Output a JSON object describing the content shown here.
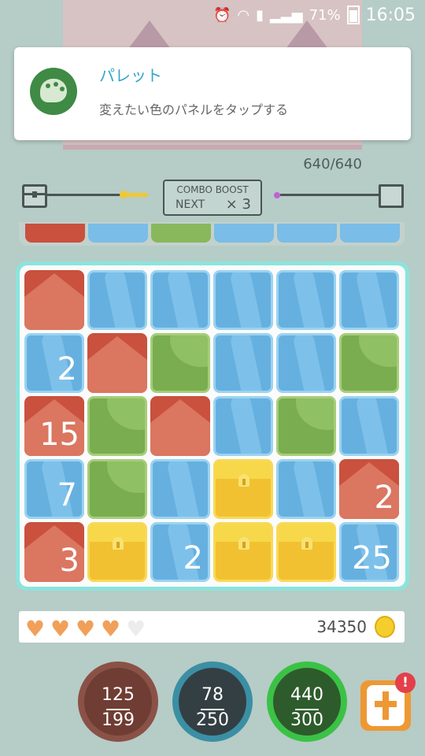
{
  "status": {
    "time": "16:05",
    "battery": "71%"
  },
  "notification": {
    "title": "パレット",
    "body": "変えたい色のパネルをタップする",
    "icon": "palette-icon"
  },
  "hp": "640/640",
  "combo": {
    "title": "COMBO BOOST",
    "next": "NEXT",
    "multiplier": "× 3"
  },
  "preview": [
    "red",
    "blue",
    "green",
    "blue",
    "blue",
    "blue"
  ],
  "board": {
    "rows": [
      [
        {
          "c": "red",
          "n": ""
        },
        {
          "c": "blue",
          "n": ""
        },
        {
          "c": "blue",
          "n": ""
        },
        {
          "c": "blue",
          "n": ""
        },
        {
          "c": "blue",
          "n": ""
        },
        {
          "c": "blue",
          "n": ""
        }
      ],
      [
        {
          "c": "blue",
          "n": "2"
        },
        {
          "c": "red",
          "n": ""
        },
        {
          "c": "green",
          "n": ""
        },
        {
          "c": "blue",
          "n": ""
        },
        {
          "c": "blue",
          "n": ""
        },
        {
          "c": "green",
          "n": ""
        }
      ],
      [
        {
          "c": "red",
          "n": "15"
        },
        {
          "c": "green",
          "n": ""
        },
        {
          "c": "red",
          "n": ""
        },
        {
          "c": "blue",
          "n": ""
        },
        {
          "c": "green",
          "n": ""
        },
        {
          "c": "blue",
          "n": ""
        }
      ],
      [
        {
          "c": "blue",
          "n": "7"
        },
        {
          "c": "green",
          "n": ""
        },
        {
          "c": "blue",
          "n": ""
        },
        {
          "c": "yellow",
          "n": ""
        },
        {
          "c": "blue",
          "n": ""
        },
        {
          "c": "red",
          "n": "2"
        }
      ],
      [
        {
          "c": "red",
          "n": "3"
        },
        {
          "c": "yellow",
          "n": ""
        },
        {
          "c": "blue",
          "n": "2"
        },
        {
          "c": "yellow",
          "n": ""
        },
        {
          "c": "yellow",
          "n": ""
        },
        {
          "c": "blue",
          "n": "25"
        }
      ]
    ]
  },
  "lives": {
    "full": 4,
    "total": 5
  },
  "coins": "34350",
  "stats": {
    "red": {
      "top": "125",
      "bottom": "199"
    },
    "blue": {
      "top": "78",
      "bottom": "250"
    },
    "green": {
      "top": "440",
      "bottom": "300"
    }
  },
  "bonus": {
    "alert": "!"
  }
}
